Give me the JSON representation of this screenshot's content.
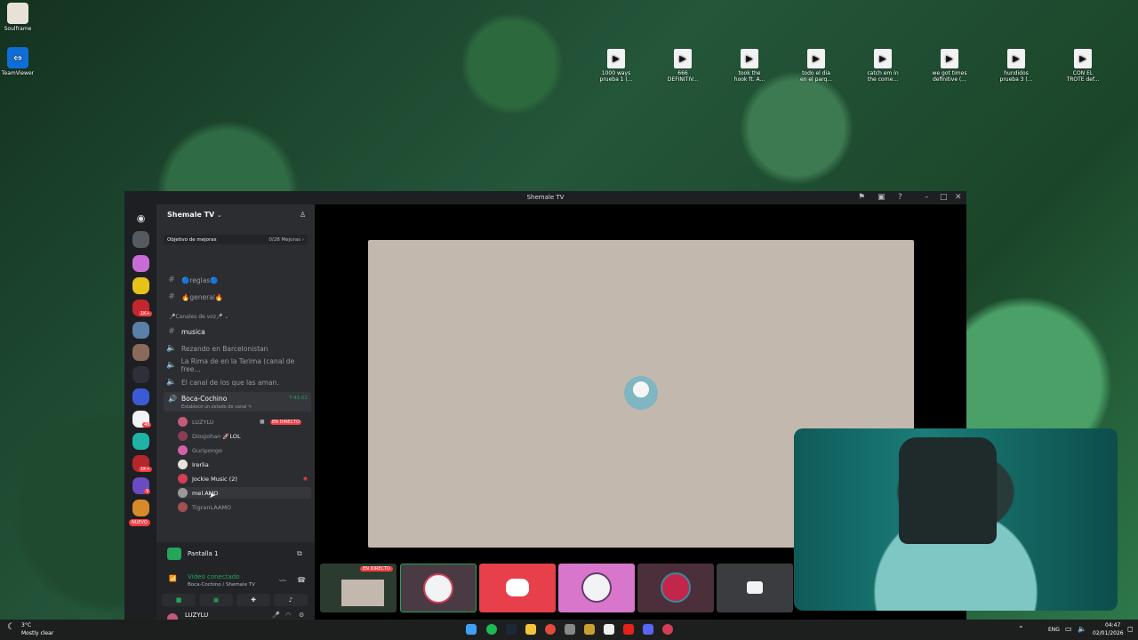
{
  "desktop": {
    "apps": [
      {
        "label": "Soulframe"
      },
      {
        "label": "TeamViewer"
      }
    ],
    "files": [
      {
        "line1": "1000 ways",
        "line2": "prueba 1 (..."
      },
      {
        "line1": "666",
        "line2": "DEFINITIV..."
      },
      {
        "line1": "took the",
        "line2": "hook ft. A..."
      },
      {
        "line1": "todo el dia",
        "line2": "en el parq..."
      },
      {
        "line1": "catch em in",
        "line2": "the corne..."
      },
      {
        "line1": "we got times",
        "line2": "definitive (..."
      },
      {
        "line1": "hundidos",
        "line2": "prueba 3 (..."
      },
      {
        "line1": "CON EL",
        "line2": "TROTE def..."
      }
    ]
  },
  "window": {
    "title": "Shemale TV"
  },
  "server": {
    "name": "Shemale TV",
    "boost_label": "Objetivo de mejoras",
    "boost_progress": "0/28 Mejoras",
    "boost_chevron": "›"
  },
  "rail": {
    "new_badge": "NUEVO",
    "badges": [
      "1K+",
      "48",
      "1K+",
      "9"
    ]
  },
  "channels": {
    "text": [
      {
        "name": "🔵reglas🔵"
      },
      {
        "name": "🔥general🔥"
      }
    ],
    "voice_category": "🎤Canales de voz🎤",
    "musica": "musica",
    "voice": [
      {
        "name": "Rezando en Barcelonistan"
      },
      {
        "name": "La Rima de en la Tarima (canal de free..."
      },
      {
        "name": "El canal de los que las aman."
      }
    ],
    "active": {
      "name": "Boca-Cochino",
      "status": "Establece un estado de canal ✎",
      "timer": "7:41:02"
    },
    "users": [
      {
        "name": "LUZYLU",
        "tag": "EN DIRECTO"
      },
      {
        "name": "DiosJohan",
        "extra": "🚀LOL"
      },
      {
        "name": "Guripongo"
      },
      {
        "name": "Irerlia"
      },
      {
        "name": "Jockie Music (2)"
      },
      {
        "name": "mel.AMO"
      },
      {
        "name": "TigranLAAMO"
      }
    ]
  },
  "panel": {
    "stream_title": "Pantalla 1",
    "connected": "Vídeo conectado",
    "location": "Boca-Cochino / Shemale TV",
    "username": "LUZYLU"
  },
  "stage": {
    "live_tag": "EN DIRECTO"
  },
  "taskbar": {
    "weather_temp": "3°C",
    "weather_desc": "Mostly clear",
    "lang": "ENG",
    "time": "04:47",
    "date": "02/01/2026"
  }
}
